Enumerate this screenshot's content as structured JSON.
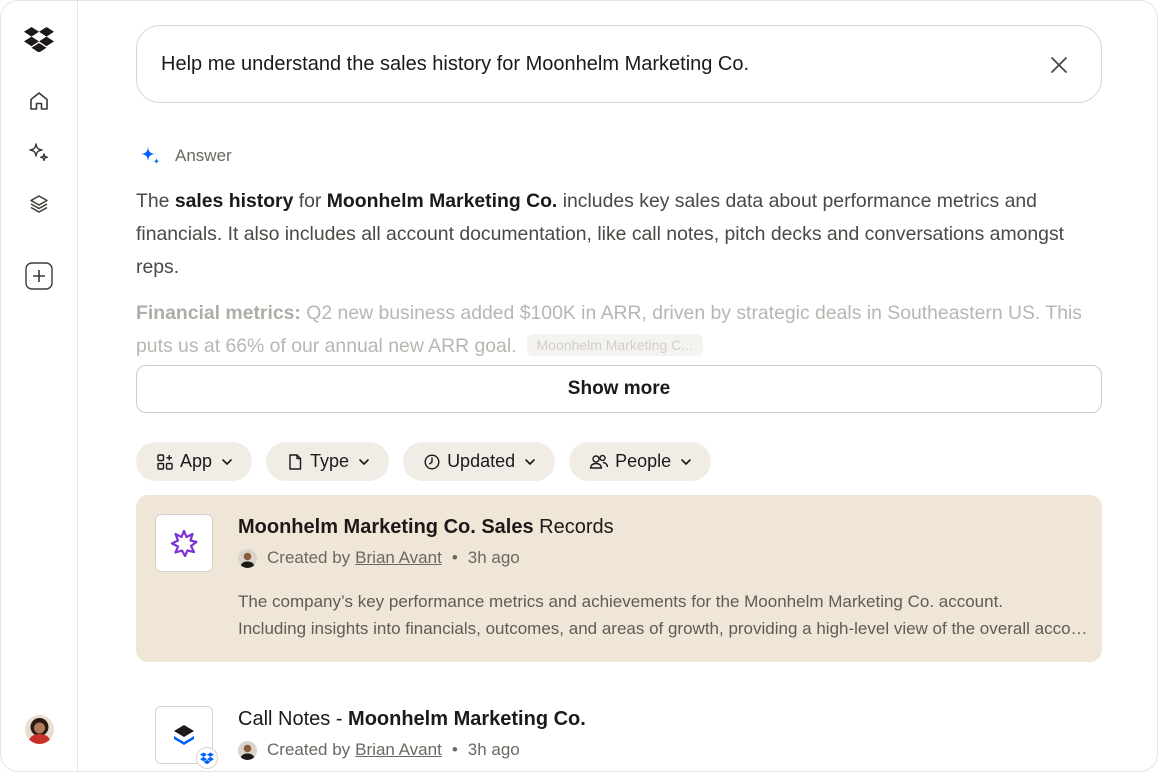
{
  "search": {
    "query": "Help me understand the sales history for Moonhelm Marketing Co."
  },
  "answer": {
    "label": "Answer",
    "p1": {
      "t1": "The ",
      "b1": "sales history",
      "t2": " for ",
      "b2": "Moonhelm Marketing Co.",
      "t3": " includes key sales data about performance metrics and financials. It also includes all account documentation, like call notes, pitch decks and conversations amongst reps."
    },
    "p2": {
      "b1": "Financial metrics:",
      "t1": " Q2 new business added $100K in ARR, driven by strategic deals in Southeastern US. This puts us at 66% of our annual new ARR goal.",
      "chip": "Moonhelm Marketing C..."
    },
    "show_more": "Show more"
  },
  "filters": [
    {
      "label": "App",
      "icon": "apps-icon"
    },
    {
      "label": "Type",
      "icon": "file-icon"
    },
    {
      "label": "Updated",
      "icon": "clock-icon"
    },
    {
      "label": "People",
      "icon": "people-icon"
    }
  ],
  "results": [
    {
      "title_bold": "Moonhelm Marketing Co. Sales",
      "title_rest": " Records",
      "created_by": "Created by",
      "author": "Brian Avant",
      "time": "3h ago",
      "desc_line1": "The company’s key performance metrics and achievements for the Moonhelm Marketing Co. account.",
      "desc_line2": "Including insights into financials, outcomes, and areas of growth, providing a high-level view of the overall account."
    },
    {
      "title_plain": "Call Notes - ",
      "title_bold": "Moonhelm Marketing Co.",
      "created_by": "Created by",
      "author": "Brian Avant",
      "time": "3h ago"
    }
  ],
  "colors": {
    "accent_blue": "#0061fe",
    "highlight": "#efe6d7",
    "chip_bg": "#f1ede6",
    "purple": "#7b32d6"
  },
  "sidebar": {
    "icons": [
      "dropbox-logo-icon",
      "home-icon",
      "sparkle-icon",
      "layers-icon",
      "plus-icon"
    ]
  }
}
